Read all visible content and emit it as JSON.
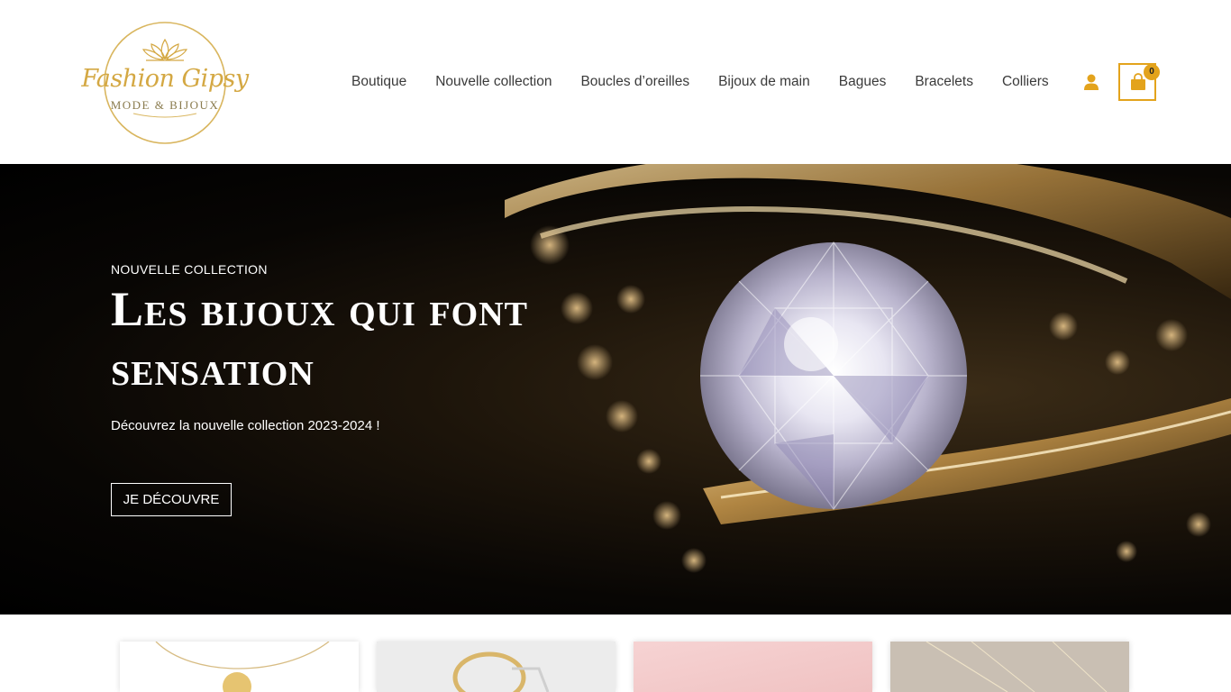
{
  "brand": {
    "name": "Fashion Gipsy",
    "tagline": "MODE & BIJOUX",
    "gold": "#d4a843"
  },
  "nav": {
    "items": [
      {
        "label": "Boutique"
      },
      {
        "label": "Nouvelle collection"
      },
      {
        "label": "Boucles d’oreilles"
      },
      {
        "label": "Bijoux de main"
      },
      {
        "label": "Bagues"
      },
      {
        "label": "Bracelets"
      },
      {
        "label": "Colliers"
      }
    ]
  },
  "header_icons": {
    "account": "user-icon",
    "cart": "shopping-bag-icon",
    "cart_count": "0",
    "accent": "#e3a31c"
  },
  "hero": {
    "eyebrow": "NOUVELLE COLLECTION",
    "title": "Les bijoux qui font sensation",
    "subtitle": "Découvrez la nouvelle collection 2023-2024 !",
    "cta_label": "JE DÉCOUVRE"
  },
  "products": [
    {
      "icon": "necklace-pendant-image"
    },
    {
      "icon": "ring-image"
    },
    {
      "icon": "pink-jewel-image"
    },
    {
      "icon": "chain-necklace-image"
    }
  ]
}
